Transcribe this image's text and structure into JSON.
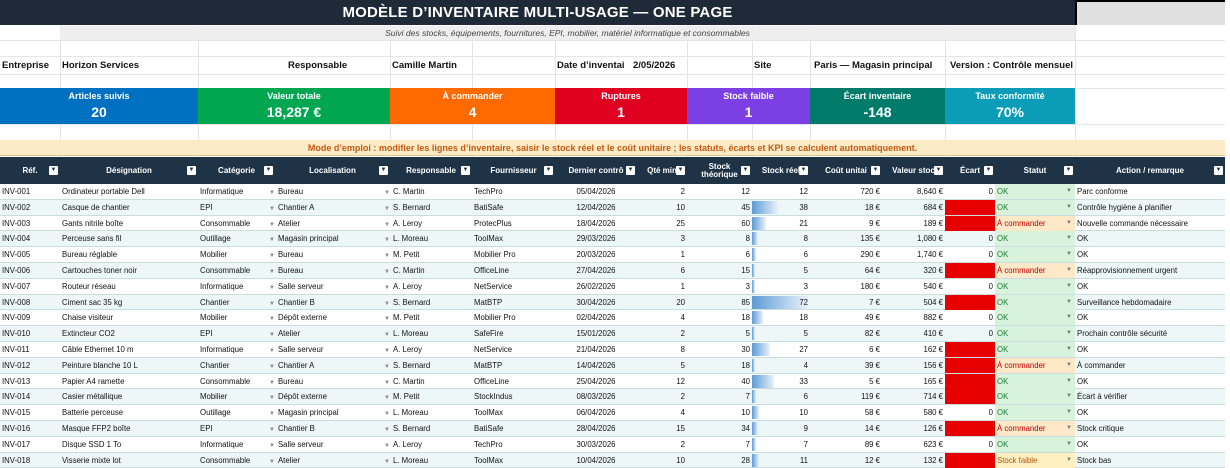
{
  "title": "MODÈLE D’INVENTAIRE MULTI-USAGE — ONE PAGE",
  "subtitle": "Suivi des stocks, équipements, fournitures, EPI, mobilier, matériel informatique et consommables",
  "info": {
    "entreprise_label": "Entreprise",
    "entreprise_value": "Horizon Services",
    "responsable_label": "Responsable",
    "responsable_value": "Camille Martin",
    "date_label": "Date d’inventai",
    "date_value": "2/05/2026",
    "site_label": "Site",
    "site_value": "Paris — Magasin principal",
    "version_label": "Version : Contrôle mensuel"
  },
  "kpis": [
    {
      "label": "Articles suivis",
      "value": "20",
      "color": "#0070c0"
    },
    {
      "label": "Valeur totale",
      "value": "18,287 €",
      "color": "#00a650"
    },
    {
      "label": "À commander",
      "value": "4",
      "color": "#ff6a00"
    },
    {
      "label": "Ruptures",
      "value": "1",
      "color": "#e00020"
    },
    {
      "label": "Stock faible",
      "value": "1",
      "color": "#7b3fe4"
    },
    {
      "label": "Écart inventaire",
      "value": "-148",
      "color": "#007a6a"
    },
    {
      "label": "Taux conformité",
      "value": "70%",
      "color": "#0b9cb8"
    }
  ],
  "mode_note": "Mode d’emploi : modifier les lignes d’inventaire, saisir le stock réel et le coût unitaire ; les statuts, écarts et KPI se calculent automatiquement.",
  "columns": [
    "Réf.",
    "Désignation",
    "Catégorie",
    "Localisation",
    "Responsable",
    "Fournisseur",
    "Dernier contrô",
    "Qté min",
    "Stock théorique",
    "Stock réel",
    "Coût unitai",
    "Valeur stoc",
    "Écart",
    "Statut",
    "Action / remarque"
  ],
  "rows": [
    {
      "ref": "INV-001",
      "designation": "Ordinateur portable Dell",
      "categorie": "Informatique",
      "localisation": "Bureau",
      "responsable": "C. Martin",
      "fournisseur": "TechPro",
      "date": "05/04/2026",
      "qte_min": "2",
      "theo": "12",
      "reel": "12",
      "cout": "720 €",
      "valeur": "8,640 €",
      "ecart": "0",
      "ecart_neg": false,
      "statut": "OK",
      "statut_type": "ok",
      "action": "Parc conforme",
      "fill": 0
    },
    {
      "ref": "INV-002",
      "designation": "Casque de chantier",
      "categorie": "EPI",
      "localisation": "Chantier A",
      "responsable": "S. Bernard",
      "fournisseur": "BatiSafe",
      "date": "12/04/2026",
      "qte_min": "10",
      "theo": "45",
      "reel": "38",
      "cout": "18 €",
      "valeur": "684 €",
      "ecart": "",
      "ecart_neg": true,
      "statut": "OK",
      "statut_type": "ok",
      "action": "Contrôle hygiène à planifier",
      "fill": 0.46
    },
    {
      "ref": "INV-003",
      "designation": "Gants nitrile boîte",
      "categorie": "Consommable",
      "localisation": "Atelier",
      "responsable": "A. Leroy",
      "fournisseur": "ProtecPlus",
      "date": "18/04/2026",
      "qte_min": "25",
      "theo": "60",
      "reel": "21",
      "cout": "9 €",
      "valeur": "189 €",
      "ecart": "",
      "ecart_neg": true,
      "statut": "À commander",
      "statut_type": "cmd",
      "action": "Nouvelle commande nécessaire",
      "fill": 0.25
    },
    {
      "ref": "INV-004",
      "designation": "Perceuse sans fil",
      "categorie": "Outillage",
      "localisation": "Magasin principal",
      "responsable": "L. Moreau",
      "fournisseur": "ToolMax",
      "date": "29/03/2026",
      "qte_min": "3",
      "theo": "8",
      "reel": "8",
      "cout": "135 €",
      "valeur": "1,080 €",
      "ecart": "0",
      "ecart_neg": false,
      "statut": "OK",
      "statut_type": "ok",
      "action": "OK",
      "fill": 0.1
    },
    {
      "ref": "INV-005",
      "designation": "Bureau réglable",
      "categorie": "Mobilier",
      "localisation": "Bureau",
      "responsable": "M. Petit",
      "fournisseur": "Mobilier Pro",
      "date": "20/03/2026",
      "qte_min": "1",
      "theo": "6",
      "reel": "6",
      "cout": "290 €",
      "valeur": "1,740 €",
      "ecart": "0",
      "ecart_neg": false,
      "statut": "OK",
      "statut_type": "ok",
      "action": "OK",
      "fill": 0.07
    },
    {
      "ref": "INV-006",
      "designation": "Cartouches toner noir",
      "categorie": "Consommable",
      "localisation": "Bureau",
      "responsable": "C. Martin",
      "fournisseur": "OfficeLine",
      "date": "27/04/2026",
      "qte_min": "6",
      "theo": "15",
      "reel": "5",
      "cout": "64 €",
      "valeur": "320 €",
      "ecart": "",
      "ecart_neg": true,
      "statut": "À commander",
      "statut_type": "cmd",
      "action": "Réapprovisionnement urgent",
      "fill": 0.06
    },
    {
      "ref": "INV-007",
      "designation": "Routeur réseau",
      "categorie": "Informatique",
      "localisation": "Salle serveur",
      "responsable": "A. Leroy",
      "fournisseur": "NetService",
      "date": "26/02/2026",
      "qte_min": "1",
      "theo": "3",
      "reel": "3",
      "cout": "180 €",
      "valeur": "540 €",
      "ecart": "0",
      "ecart_neg": false,
      "statut": "OK",
      "statut_type": "ok",
      "action": "OK",
      "fill": 0.03
    },
    {
      "ref": "INV-008",
      "designation": "Ciment sac 35 kg",
      "categorie": "Chantier",
      "localisation": "Chantier B",
      "responsable": "S. Bernard",
      "fournisseur": "MatBTP",
      "date": "30/04/2026",
      "qte_min": "20",
      "theo": "85",
      "reel": "72",
      "cout": "7 €",
      "valeur": "504 €",
      "ecart": "",
      "ecart_neg": true,
      "statut": "OK",
      "statut_type": "ok",
      "action": "Surveillance hebdomadaire",
      "fill": 1.0
    },
    {
      "ref": "INV-009",
      "designation": "Chaise visiteur",
      "categorie": "Mobilier",
      "localisation": "Dépôt externe",
      "responsable": "M. Petit",
      "fournisseur": "Mobilier Pro",
      "date": "02/04/2026",
      "qte_min": "4",
      "theo": "18",
      "reel": "18",
      "cout": "49 €",
      "valeur": "882 €",
      "ecart": "0",
      "ecart_neg": false,
      "statut": "OK",
      "statut_type": "ok",
      "action": "OK",
      "fill": 0.2
    },
    {
      "ref": "INV-010",
      "designation": "Extincteur CO2",
      "categorie": "EPI",
      "localisation": "Atelier",
      "responsable": "L. Moreau",
      "fournisseur": "SafeFire",
      "date": "15/01/2026",
      "qte_min": "2",
      "theo": "5",
      "reel": "5",
      "cout": "82 €",
      "valeur": "410 €",
      "ecart": "0",
      "ecart_neg": false,
      "statut": "OK",
      "statut_type": "ok",
      "action": "Prochain contrôle sécurité",
      "fill": 0.06
    },
    {
      "ref": "INV-011",
      "designation": "Câble Ethernet 10 m",
      "categorie": "Informatique",
      "localisation": "Salle serveur",
      "responsable": "A. Leroy",
      "fournisseur": "NetService",
      "date": "21/04/2026",
      "qte_min": "8",
      "theo": "30",
      "reel": "27",
      "cout": "6 €",
      "valeur": "162 €",
      "ecart": "",
      "ecart_neg": true,
      "statut": "OK",
      "statut_type": "ok",
      "action": "OK",
      "fill": 0.33
    },
    {
      "ref": "INV-012",
      "designation": "Peinture blanche 10 L",
      "categorie": "Chantier",
      "localisation": "Chantier A",
      "responsable": "S. Bernard",
      "fournisseur": "MatBTP",
      "date": "14/04/2026",
      "qte_min": "5",
      "theo": "18",
      "reel": "4",
      "cout": "39 €",
      "valeur": "156 €",
      "ecart": "",
      "ecart_neg": true,
      "statut": "À commander",
      "statut_type": "cmd",
      "action": "À commander",
      "fill": 0.05
    },
    {
      "ref": "INV-013",
      "designation": "Papier A4 ramette",
      "categorie": "Consommable",
      "localisation": "Bureau",
      "responsable": "C. Martin",
      "fournisseur": "OfficeLine",
      "date": "25/04/2026",
      "qte_min": "12",
      "theo": "40",
      "reel": "33",
      "cout": "5 €",
      "valeur": "165 €",
      "ecart": "",
      "ecart_neg": true,
      "statut": "OK",
      "statut_type": "ok",
      "action": "OK",
      "fill": 0.4
    },
    {
      "ref": "INV-014",
      "designation": "Casier métallique",
      "categorie": "Mobilier",
      "localisation": "Dépôt externe",
      "responsable": "M. Petit",
      "fournisseur": "StockIndus",
      "date": "08/03/2026",
      "qte_min": "2",
      "theo": "7",
      "reel": "6",
      "cout": "119 €",
      "valeur": "714 €",
      "ecart": "",
      "ecart_neg": true,
      "statut": "OK",
      "statut_type": "ok",
      "action": "Écart à vérifier",
      "fill": 0.07
    },
    {
      "ref": "INV-015",
      "designation": "Batterie perceuse",
      "categorie": "Outillage",
      "localisation": "Magasin principal",
      "responsable": "L. Moreau",
      "fournisseur": "ToolMax",
      "date": "06/04/2026",
      "qte_min": "4",
      "theo": "10",
      "reel": "10",
      "cout": "58 €",
      "valeur": "580 €",
      "ecart": "0",
      "ecart_neg": false,
      "statut": "OK",
      "statut_type": "ok",
      "action": "OK",
      "fill": 0.12
    },
    {
      "ref": "INV-016",
      "designation": "Masque FFP2 boîte",
      "categorie": "EPI",
      "localisation": "Chantier B",
      "responsable": "S. Bernard",
      "fournisseur": "BatiSafe",
      "date": "28/04/2026",
      "qte_min": "15",
      "theo": "34",
      "reel": "9",
      "cout": "14 €",
      "valeur": "126 €",
      "ecart": "",
      "ecart_neg": true,
      "statut": "À commander",
      "statut_type": "cmd",
      "action": "Stock critique",
      "fill": 0.11
    },
    {
      "ref": "INV-017",
      "designation": "Disque SSD 1 To",
      "categorie": "Informatique",
      "localisation": "Salle serveur",
      "responsable": "A. Leroy",
      "fournisseur": "TechPro",
      "date": "30/03/2026",
      "qte_min": "2",
      "theo": "7",
      "reel": "7",
      "cout": "89 €",
      "valeur": "623 €",
      "ecart": "0",
      "ecart_neg": false,
      "statut": "OK",
      "statut_type": "ok",
      "action": "OK",
      "fill": 0.08
    },
    {
      "ref": "INV-018",
      "designation": "Visserie mixte lot",
      "categorie": "Consommable",
      "localisation": "Atelier",
      "responsable": "L. Moreau",
      "fournisseur": "ToolMax",
      "date": "10/04/2026",
      "qte_min": "10",
      "theo": "28",
      "reel": "11",
      "cout": "12 €",
      "valeur": "132 €",
      "ecart": "",
      "ecart_neg": true,
      "statut": "Stock faible",
      "statut_type": "low",
      "action": "Stock bas",
      "fill": 0.13
    }
  ]
}
